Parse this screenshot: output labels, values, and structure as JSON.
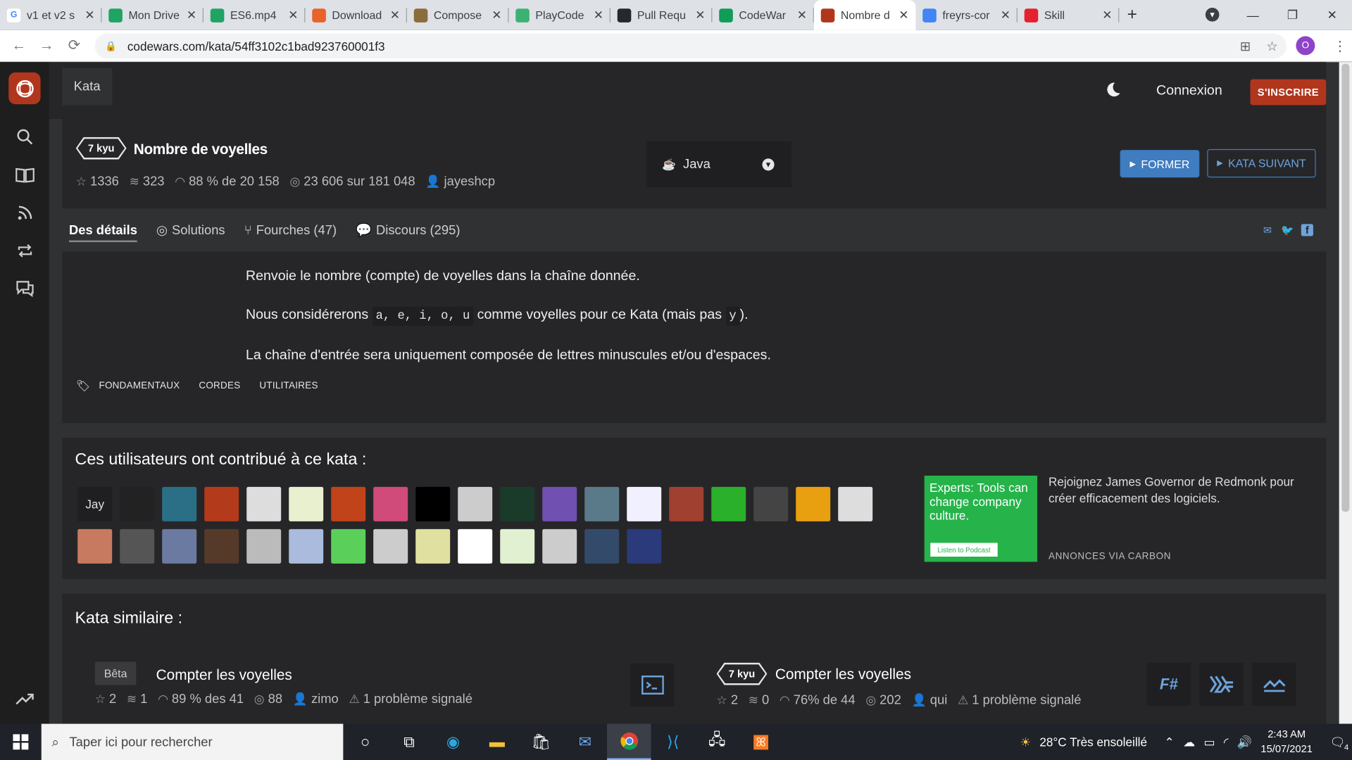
{
  "browser": {
    "tabs": [
      {
        "title": "v1 et v2 s",
        "fav": "G",
        "color": "#fff"
      },
      {
        "title": "Mon Drive",
        "fav": "drive",
        "color": "#1fa463"
      },
      {
        "title": "ES6.mp4",
        "fav": "drive",
        "color": "#1fa463"
      },
      {
        "title": "Download",
        "fav": "orange",
        "color": "#e8622a"
      },
      {
        "title": "Compose",
        "fav": "cup",
        "color": "#8a6d3b"
      },
      {
        "title": "PlayCode",
        "fav": "play",
        "color": "#3bb273"
      },
      {
        "title": "Pull Requ",
        "fav": "github",
        "color": "#24292e"
      },
      {
        "title": "CodeWar",
        "fav": "plus",
        "color": "#0f9d58"
      },
      {
        "title": "Nombre d",
        "fav": "cw",
        "color": "#b1361e"
      },
      {
        "title": "freyrs-cor",
        "fav": "ring",
        "color": "#4285f4"
      },
      {
        "title": "Skill",
        "fav": "opera",
        "color": "#e4212f"
      }
    ],
    "url": "codewars.com/kata/54ff3102c1bad923760001f3",
    "profile_initial": "O"
  },
  "header": {
    "kata_tab": "Kata",
    "login": "Connexion",
    "signup": "S'INSCRIRE"
  },
  "kata": {
    "rank": "7 kyu",
    "title": "Nombre de voyelles",
    "stars": "1336",
    "collections": "323",
    "satisfaction": "88 % de 20 158",
    "completed": "23 606 sur 181 048",
    "author": "jayeshcp",
    "language": "Java",
    "train_label": "FORMER",
    "next_label": "KATA SUIVANT"
  },
  "detail_tabs": {
    "details": "Des détails",
    "solutions": "Solutions",
    "forks": "Fourches (47)",
    "discourse": "Discours (295)"
  },
  "description": {
    "p1": "Renvoie le nombre (compte) de voyelles dans la chaîne donnée.",
    "p2_before": "Nous considérerons ",
    "p2_code": "a, e, i, o, u",
    "p2_middle": " comme voyelles pour ce Kata (mais pas ",
    "p2_code2": "y",
    "p2_after": ").",
    "p3": "La chaîne d'entrée sera uniquement composée de lettres minuscules et/ou d'espaces.",
    "tags": [
      "FONDAMENTAUX",
      "CORDES",
      "UTILITAIRES"
    ]
  },
  "contributors": {
    "heading": "Ces utilisateurs ont contribué à ce kata :",
    "first_label": "Jay",
    "avatar_colors": [
      "#222",
      "#2a6f86",
      "#b33a1a",
      "#ddd",
      "#e8f0d0",
      "#c0431a",
      "#d04a7a",
      "#000",
      "#ccc",
      "#1a3a2a",
      "#7050b0",
      "#5a7a8a",
      "#f0f0ff",
      "#a04030",
      "#2ab02a",
      "#444",
      "#e8a010",
      "#ddd",
      "#c87a60",
      "#555",
      "#6a7aa0",
      "#553a2a",
      "#bbb",
      "#aabbdd",
      "#5ad05a",
      "#ccc",
      "#e0e0a0",
      "#fff",
      "#e0f0d0",
      "#ccc",
      "#334a6a",
      "#2a3a7a"
    ],
    "ad_text": "Experts: Tools can change company culture.",
    "ad_button": "Listen to Podcast",
    "ad_copy": "Rejoignez James Governor de Redmonk pour créer efficacement des logiciels.",
    "ad_footer": "ANNONCES VIA CARBON"
  },
  "similar": {
    "heading": "Kata similaire :",
    "items": [
      {
        "badge": "Bêta",
        "title": "Compter les voyelles",
        "stars": "2",
        "collections": "1",
        "satisfaction": "89 % des 41",
        "completed": "88",
        "author": "zimo",
        "issues": "1 problème signalé"
      },
      {
        "badge": "7 kyu",
        "title": "Compter les voyelles",
        "stars": "2",
        "collections": "0",
        "satisfaction": "76% de 44",
        "completed": "202",
        "author": "qui",
        "issues": "1 problème signalé"
      }
    ],
    "lang_icons": [
      "F#",
      "Haskell",
      "Elm"
    ]
  },
  "taskbar": {
    "search_placeholder": "Taper ici pour rechercher",
    "weather": "28°C  Très ensoleillé",
    "time": "2:43 AM",
    "date": "15/07/2021",
    "notif_count": "4"
  }
}
